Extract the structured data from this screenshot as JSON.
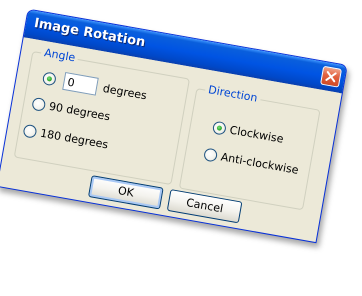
{
  "window": {
    "title": "Image Rotation",
    "close_icon": "close-icon"
  },
  "angle_group": {
    "label": "Angle",
    "custom_value": "0",
    "custom_suffix": "degrees",
    "options": [
      {
        "label": "90 degrees",
        "checked": false
      },
      {
        "label": "180 degrees",
        "checked": false
      }
    ],
    "custom_checked": true
  },
  "direction_group": {
    "label": "Direction",
    "options": [
      {
        "label": "Clockwise",
        "checked": true
      },
      {
        "label": "Anti-clockwise",
        "checked": false
      }
    ]
  },
  "buttons": {
    "ok_label": "OK",
    "cancel_label": "Cancel"
  },
  "colors": {
    "titlebar": "#0054e3",
    "dialog_bg": "#ece9d8",
    "group_label": "#0046d5",
    "close_button": "#e2613f"
  }
}
